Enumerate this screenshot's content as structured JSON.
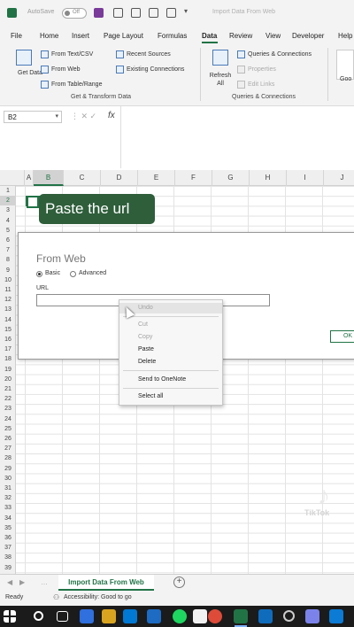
{
  "titlebar": {
    "autosave_label": "AutoSave",
    "autosave_state": "Off",
    "doc_title": "Import Data From Web"
  },
  "tabs": [
    "File",
    "Home",
    "Insert",
    "Page Layout",
    "Formulas",
    "Data",
    "Review",
    "View",
    "Developer",
    "Help"
  ],
  "active_tab": "Data",
  "ribbon": {
    "get_data": "Get Data",
    "from_text_csv": "From Text/CSV",
    "from_web": "From Web",
    "from_table_range": "From Table/Range",
    "recent_sources": "Recent Sources",
    "existing_connections": "Existing Connections",
    "group_get_transform": "Get & Transform Data",
    "refresh_all": "Refresh All",
    "queries_connections": "Queries & Connections",
    "properties": "Properties",
    "edit_links": "Edit Links",
    "group_queries": "Queries & Connections",
    "goo": "Goo"
  },
  "formula_bar": {
    "name_box": "B2",
    "fx": "fx"
  },
  "columns": [
    "A",
    "B",
    "C",
    "D",
    "E",
    "F",
    "G",
    "H",
    "I",
    "J"
  ],
  "selected_column": "B",
  "rows": [
    "1",
    "2",
    "3",
    "4",
    "5",
    "6",
    "7",
    "8",
    "9",
    "10",
    "11",
    "12",
    "13",
    "14",
    "15",
    "16",
    "17",
    "18",
    "19",
    "20",
    "21",
    "22",
    "23",
    "24",
    "25",
    "26",
    "27",
    "28",
    "29",
    "30",
    "31",
    "32",
    "33",
    "34",
    "35",
    "36",
    "37",
    "38",
    "39"
  ],
  "selected_row": "2",
  "caption": "Paste the url",
  "dialog": {
    "title": "From Web",
    "basic": "Basic",
    "advanced": "Advanced",
    "url_label": "URL",
    "ok": "OK"
  },
  "context_menu": {
    "undo": "Undo",
    "cut": "Cut",
    "copy": "Copy",
    "paste": "Paste",
    "delete": "Delete",
    "send_onenote": "Send to OneNote",
    "select_all": "Select all"
  },
  "watermark": {
    "logo": "♪",
    "text": "TikTok"
  },
  "sheet_tab": "Import Data From Web",
  "status": {
    "ready": "Ready",
    "accessibility": "Accessibility: Good to go"
  },
  "colors": {
    "excel_green": "#217346",
    "caption_bg": "#2e5e3a"
  }
}
